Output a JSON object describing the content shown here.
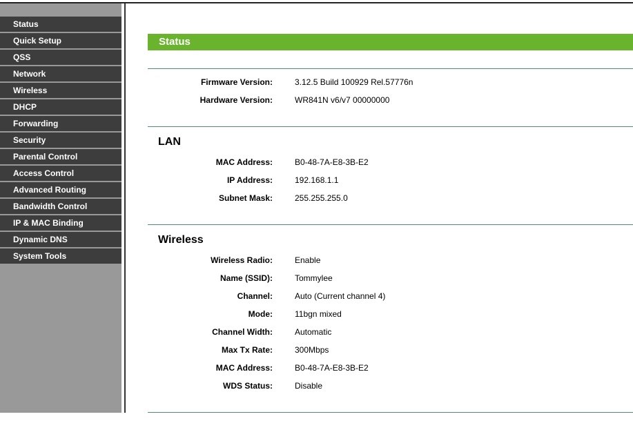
{
  "sidebar": {
    "items": [
      {
        "label": "Status"
      },
      {
        "label": "Quick Setup"
      },
      {
        "label": "QSS"
      },
      {
        "label": "Network"
      },
      {
        "label": "Wireless"
      },
      {
        "label": "DHCP"
      },
      {
        "label": "Forwarding"
      },
      {
        "label": "Security"
      },
      {
        "label": "Parental Control"
      },
      {
        "label": "Access Control"
      },
      {
        "label": "Advanced Routing"
      },
      {
        "label": "Bandwidth Control"
      },
      {
        "label": "IP & MAC Binding"
      },
      {
        "label": "Dynamic DNS"
      },
      {
        "label": "System Tools"
      }
    ]
  },
  "main": {
    "title": "Status",
    "general": {
      "firmware_label": "Firmware Version:",
      "firmware_value": "3.12.5 Build 100929 Rel.57776n",
      "hardware_label": "Hardware Version:",
      "hardware_value": "WR841N v6/v7 00000000"
    },
    "lan": {
      "title": "LAN",
      "mac_label": "MAC Address:",
      "mac_value": "B0-48-7A-E8-3B-E2",
      "ip_label": "IP Address:",
      "ip_value": "192.168.1.1",
      "mask_label": "Subnet Mask:",
      "mask_value": "255.255.255.0"
    },
    "wireless": {
      "title": "Wireless",
      "radio_label": "Wireless Radio:",
      "radio_value": "Enable",
      "ssid_label": "Name (SSID):",
      "ssid_value": "Tommylee",
      "channel_label": "Channel:",
      "channel_value": "Auto (Current channel 4)",
      "mode_label": "Mode:",
      "mode_value": "11bgn mixed",
      "width_label": "Channel Width:",
      "width_value": "Automatic",
      "rate_label": "Max Tx Rate:",
      "rate_value": "300Mbps",
      "mac_label": "MAC Address:",
      "mac_value": "B0-48-7A-E8-3B-E2",
      "wds_label": "WDS Status:",
      "wds_value": "Disable"
    }
  },
  "colors": {
    "title_bar": "#6ab42d",
    "sidebar_item": "#3d3d3d",
    "sidebar_bg": "#999999",
    "section_rule": "#4a8f73"
  }
}
